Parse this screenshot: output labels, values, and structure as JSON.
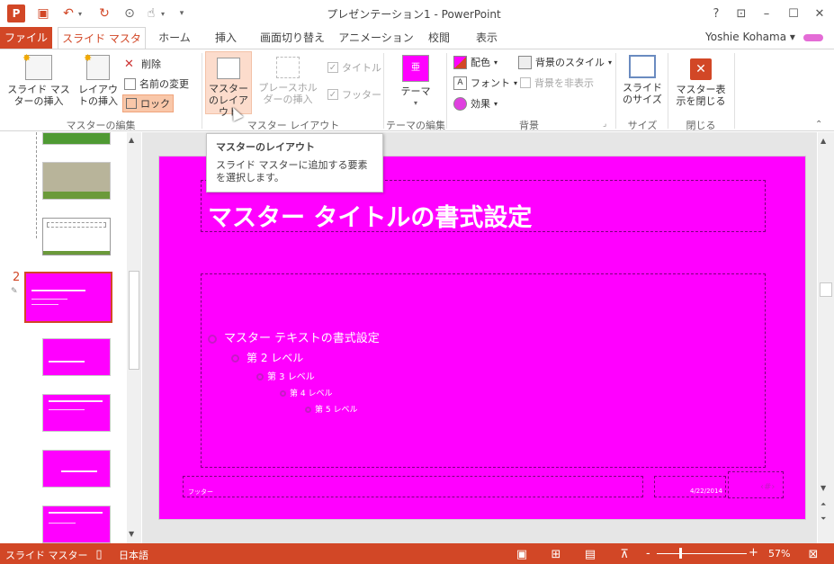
{
  "window": {
    "title": "プレゼンテーション1 - PowerPoint",
    "help": "?",
    "minimize": "–",
    "restore": "☐",
    "close": "✕"
  },
  "tabs": {
    "file": "ファイル",
    "slide_master": "スライド マスター",
    "home": "ホーム",
    "insert": "挿入",
    "transitions": "画面切り替え",
    "animations": "アニメーション",
    "review": "校閲",
    "view": "表示"
  },
  "user": {
    "name": "Yoshie Kohama"
  },
  "ribbon": {
    "edit_master": {
      "group": "マスターの編集",
      "insert_slide_master": "スライド マスターの挿入",
      "insert_layout": "レイアウトの挿入",
      "delete": "削除",
      "rename": "名前の変更",
      "preserve": "ロック"
    },
    "master_layout": {
      "group": "マスター レイアウト",
      "master_layout": "マスターのレイアウト",
      "insert_placeholder": "プレースホルダーの挿入",
      "title": "タイトル",
      "footers": "フッター"
    },
    "edit_theme": {
      "group": "テーマの編集",
      "themes": "テーマ"
    },
    "background": {
      "group": "背景",
      "colors": "配色",
      "fonts": "フォント",
      "effects": "効果",
      "background_styles": "背景のスタイル",
      "hide_background": "背景を非表示"
    },
    "size": {
      "group": "サイズ",
      "slide_size": "スライドのサイズ"
    },
    "close": {
      "group": "閉じる",
      "close_master": "マスター表示を閉じる"
    }
  },
  "tooltip": {
    "title": "マスターのレイアウト",
    "body": "スライド マスターに追加する要素を選択します。"
  },
  "thumbnails": {
    "selected_number": "2"
  },
  "slide": {
    "title": "マスター タイトルの書式設定",
    "levels": [
      "マスター テキストの書式設定",
      "第 2 レベル",
      "第 3 レベル",
      "第 4 レベル",
      "第 5 レベル"
    ],
    "footer": "フッター",
    "date": "4/22/2014",
    "number": "‹#›",
    "background_color": "#ff00ff"
  },
  "status": {
    "mode": "スライド マスター",
    "language": "日本語",
    "zoom": "57%",
    "zoom_minus": "-",
    "zoom_plus": "+"
  },
  "colors": {
    "accent": "#d24726",
    "slide_bg": "#ff00ff"
  }
}
